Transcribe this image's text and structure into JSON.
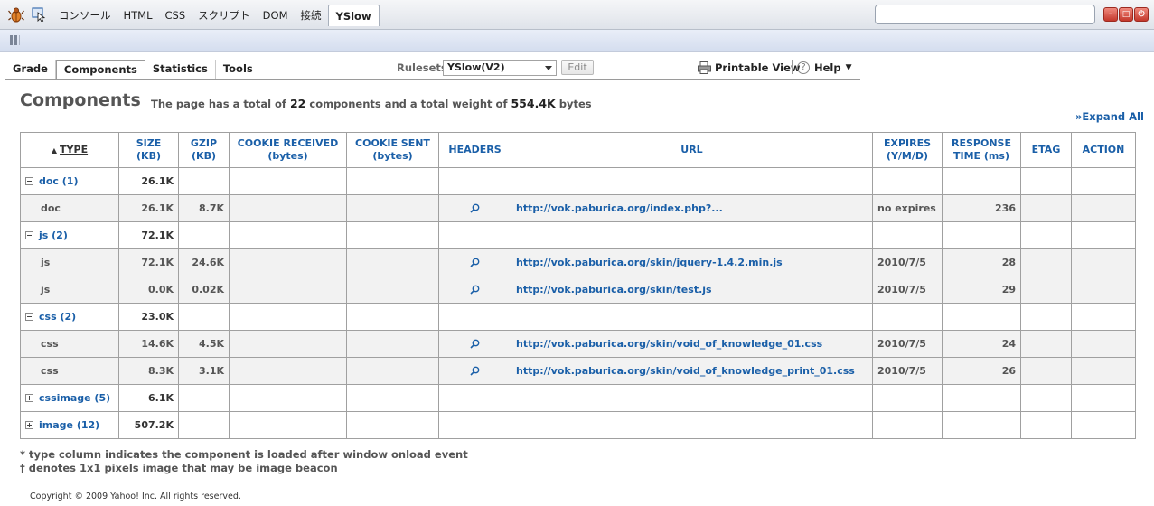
{
  "firebug": {
    "tabs": [
      "コンソール",
      "HTML",
      "CSS",
      "スクリプト",
      "DOM",
      "接続",
      "YSlow"
    ],
    "active_tab": "YSlow",
    "search_placeholder": "",
    "window_buttons": [
      "–",
      "□",
      "⏻"
    ]
  },
  "yslow": {
    "nav": [
      "Grade",
      "Components",
      "Statistics",
      "Tools"
    ],
    "active_nav": "Components",
    "rulesets_label": "Rulesets",
    "ruleset_selected": "YSlow(V2)",
    "edit_label": "Edit",
    "printable_label": "Printable View",
    "help_label": "Help",
    "help_caret": "▼"
  },
  "components": {
    "title": "Components",
    "summary_prefix": "The page has a total of",
    "total_components": "22",
    "summary_middle": "components and a total weight of",
    "total_weight": "554.4K",
    "summary_suffix": "bytes",
    "expand_all": "»Expand All"
  },
  "table": {
    "headers": {
      "type": "TYPE",
      "size": [
        "SIZE",
        "(KB)"
      ],
      "gzip": [
        "GZIP",
        "(KB)"
      ],
      "cookie_received": [
        "COOKIE RECEIVED",
        "(bytes)"
      ],
      "cookie_sent": [
        "COOKIE SENT",
        "(bytes)"
      ],
      "headers": "HEADERS",
      "url": "URL",
      "expires": [
        "EXPIRES",
        "(Y/M/D)"
      ],
      "response": [
        "RESPONSE",
        "TIME (ms)"
      ],
      "etag": "ETAG",
      "action": "ACTION"
    },
    "rows": [
      {
        "kind": "group",
        "expanded": true,
        "type": "doc (1)",
        "size": "26.1K"
      },
      {
        "kind": "item",
        "type": "doc",
        "size": "26.1K",
        "gzip": "8.7K",
        "url": "http://vok.paburica.org/index.php?...",
        "expires": "no expires",
        "response": "236"
      },
      {
        "kind": "group",
        "expanded": true,
        "type": "js (2)",
        "size": "72.1K"
      },
      {
        "kind": "item",
        "type": "js",
        "size": "72.1K",
        "gzip": "24.6K",
        "url": "http://vok.paburica.org/skin/jquery-1.4.2.min.js",
        "expires": "2010/7/5",
        "response": "28"
      },
      {
        "kind": "item",
        "type": "js",
        "size": "0.0K",
        "gzip": "0.02K",
        "url": "http://vok.paburica.org/skin/test.js",
        "expires": "2010/7/5",
        "response": "29"
      },
      {
        "kind": "group",
        "expanded": true,
        "type": "css (2)",
        "size": "23.0K"
      },
      {
        "kind": "item",
        "type": "css",
        "size": "14.6K",
        "gzip": "4.5K",
        "url": "http://vok.paburica.org/skin/void_of_knowledge_01.css",
        "expires": "2010/7/5",
        "response": "24"
      },
      {
        "kind": "item",
        "type": "css",
        "size": "8.3K",
        "gzip": "3.1K",
        "url": "http://vok.paburica.org/skin/void_of_knowledge_print_01.css",
        "expires": "2010/7/5",
        "response": "26"
      },
      {
        "kind": "group",
        "expanded": false,
        "type": "cssimage (5)",
        "size": "6.1K"
      },
      {
        "kind": "group",
        "expanded": false,
        "type": "image (12)",
        "size": "507.2K"
      }
    ]
  },
  "footnotes": [
    "* type column indicates the component is loaded after window onload event",
    "† denotes 1x1 pixels image that may be image beacon"
  ],
  "copyright": "Copyright © 2009 Yahoo! Inc. All rights reserved."
}
